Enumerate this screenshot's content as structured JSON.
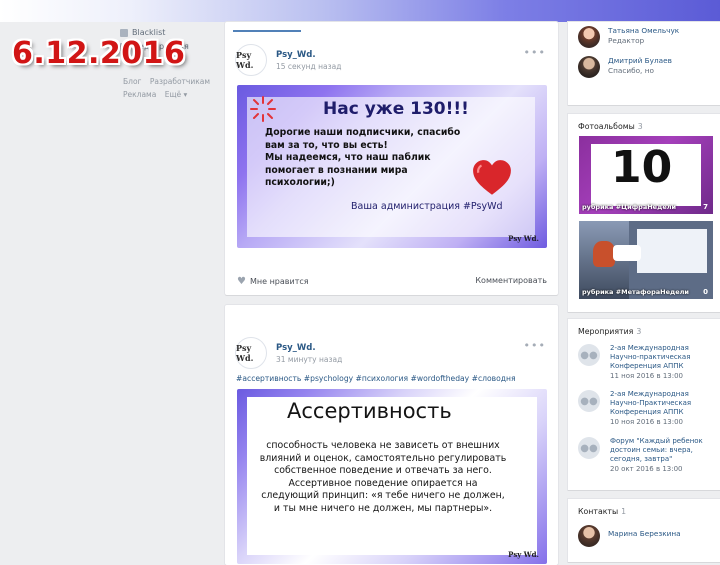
{
  "overlay": {
    "date": "6.12.2016"
  },
  "left_menu": {
    "items": [
      {
        "label": "Blacklist"
      },
      {
        "label": "Мероприятия"
      }
    ],
    "footer": [
      "Блог",
      "Разработчикам",
      "Реклама",
      "Ещё ▾"
    ]
  },
  "posts": [
    {
      "author": "Psy_Wd.",
      "time": "15 секунд назад",
      "avatar_text": "Psy Wd.",
      "image": {
        "headline": "Нас уже 130!!!",
        "lines": [
          "Дорогие наши подписчики, спасибо",
          "вам за то, что вы есть!",
          "Мы надеемся, что наш паблик",
          "помогает в познании мира",
          "психологии;)"
        ],
        "signature": "Ваша администрация #PsyWd",
        "brand": "Psy Wd."
      },
      "like_label": "Мне нравится",
      "comment_label": "Комментировать"
    },
    {
      "author": "Psy_Wd.",
      "time": "31 минуту назад",
      "avatar_text": "Psy Wd.",
      "hashtags": "#ассертивность #psychology #психология #wordoftheday #словодня",
      "image": {
        "title": "Ассертивность",
        "lines": [
          "способность человека не зависеть от внешних",
          "влияний и оценок, самостоятельно регулировать",
          "собственное поведение и отвечать за него.",
          "Ассертивное поведение опирается на",
          "следующий принцип: «я тебе ничего не должен,",
          "и ты мне ничего не должен, мы партнеры»."
        ],
        "brand": "Psy Wd."
      }
    }
  ],
  "right": {
    "contacts_top": [
      {
        "name": "Татьяна Омельчук",
        "role": "Редактор"
      },
      {
        "name": "Дмитрий Булаев",
        "role": "Спасибо, но"
      }
    ],
    "albums": {
      "title": "Фотоальбомы",
      "count": "3",
      "items": [
        {
          "caption": "рубрика #ЦифраНедели",
          "count": "7",
          "big": "10"
        },
        {
          "caption": "рубрика #МетафораНедели",
          "count": "0"
        }
      ]
    },
    "events": {
      "title": "Мероприятия",
      "count": "3",
      "items": [
        {
          "name": "2-ая Международная Научно-практическая Конференция АППК",
          "date": "11 ноя 2016 в 13:00"
        },
        {
          "name": "2-ая Международная Научно-Практическая Конференция АППК",
          "date": "10 ноя 2016 в 13:00"
        },
        {
          "name": "Форум \"Каждый ребенок достоин семьи: вчера, сегодня, завтра\"",
          "date": "20 окт 2016 в 13:00"
        }
      ]
    },
    "contacts": {
      "title": "Контакты",
      "count": "1",
      "items": [
        {
          "name": "Марина Березкина"
        }
      ]
    }
  }
}
